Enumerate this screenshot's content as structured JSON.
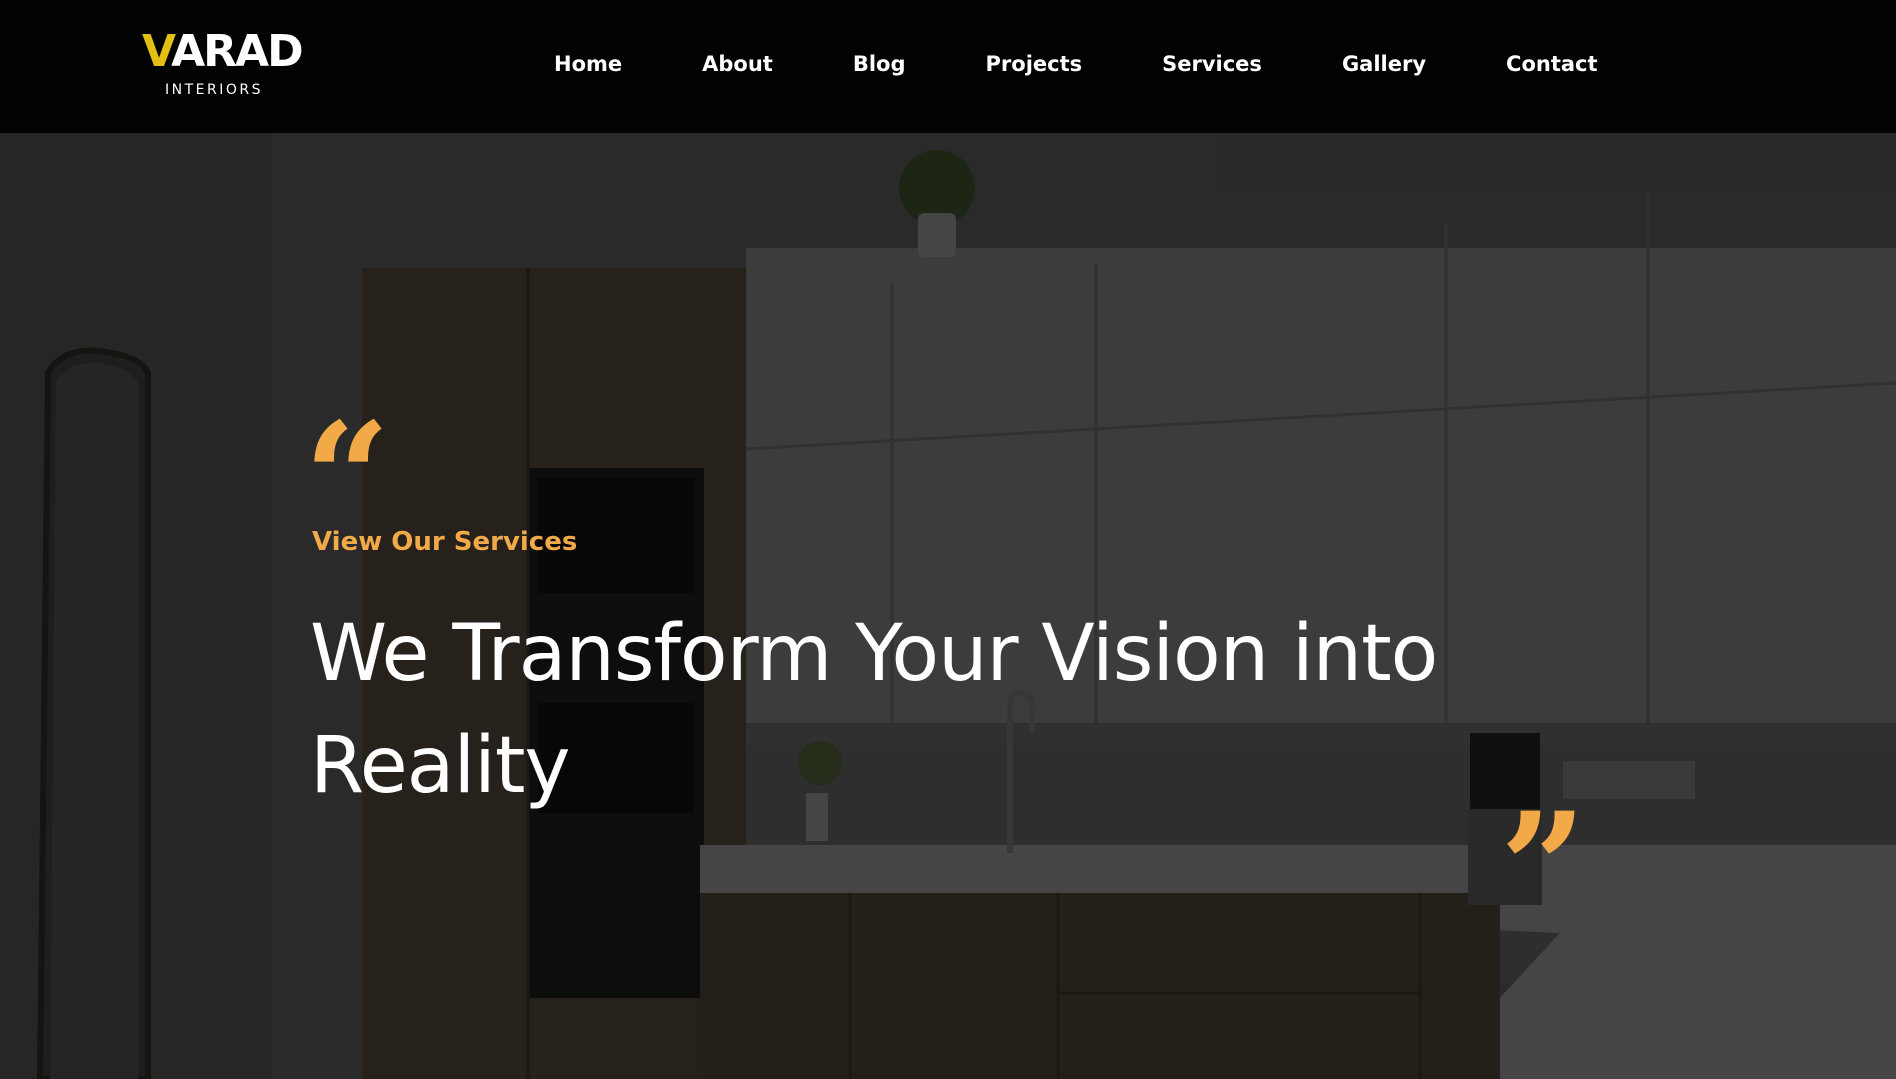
{
  "brand": {
    "logo_mark_v": "V",
    "logo_mark_rest": "ARAD",
    "logo_sub": "INTERIORS",
    "accent_color": "#e2bf12"
  },
  "nav": {
    "items": [
      {
        "label": "Home"
      },
      {
        "label": "About"
      },
      {
        "label": "Blog"
      },
      {
        "label": "Projects"
      },
      {
        "label": "Services"
      },
      {
        "label": "Gallery"
      },
      {
        "label": "Contact"
      }
    ]
  },
  "hero": {
    "eyebrow": "View Our Services",
    "headline": "We Transform Your Vision into Reality",
    "quote_open_icon": "quote-open-icon",
    "quote_close_icon": "quote-close-icon",
    "highlight_color": "#f2a948",
    "background_image": "kitchen interior"
  }
}
